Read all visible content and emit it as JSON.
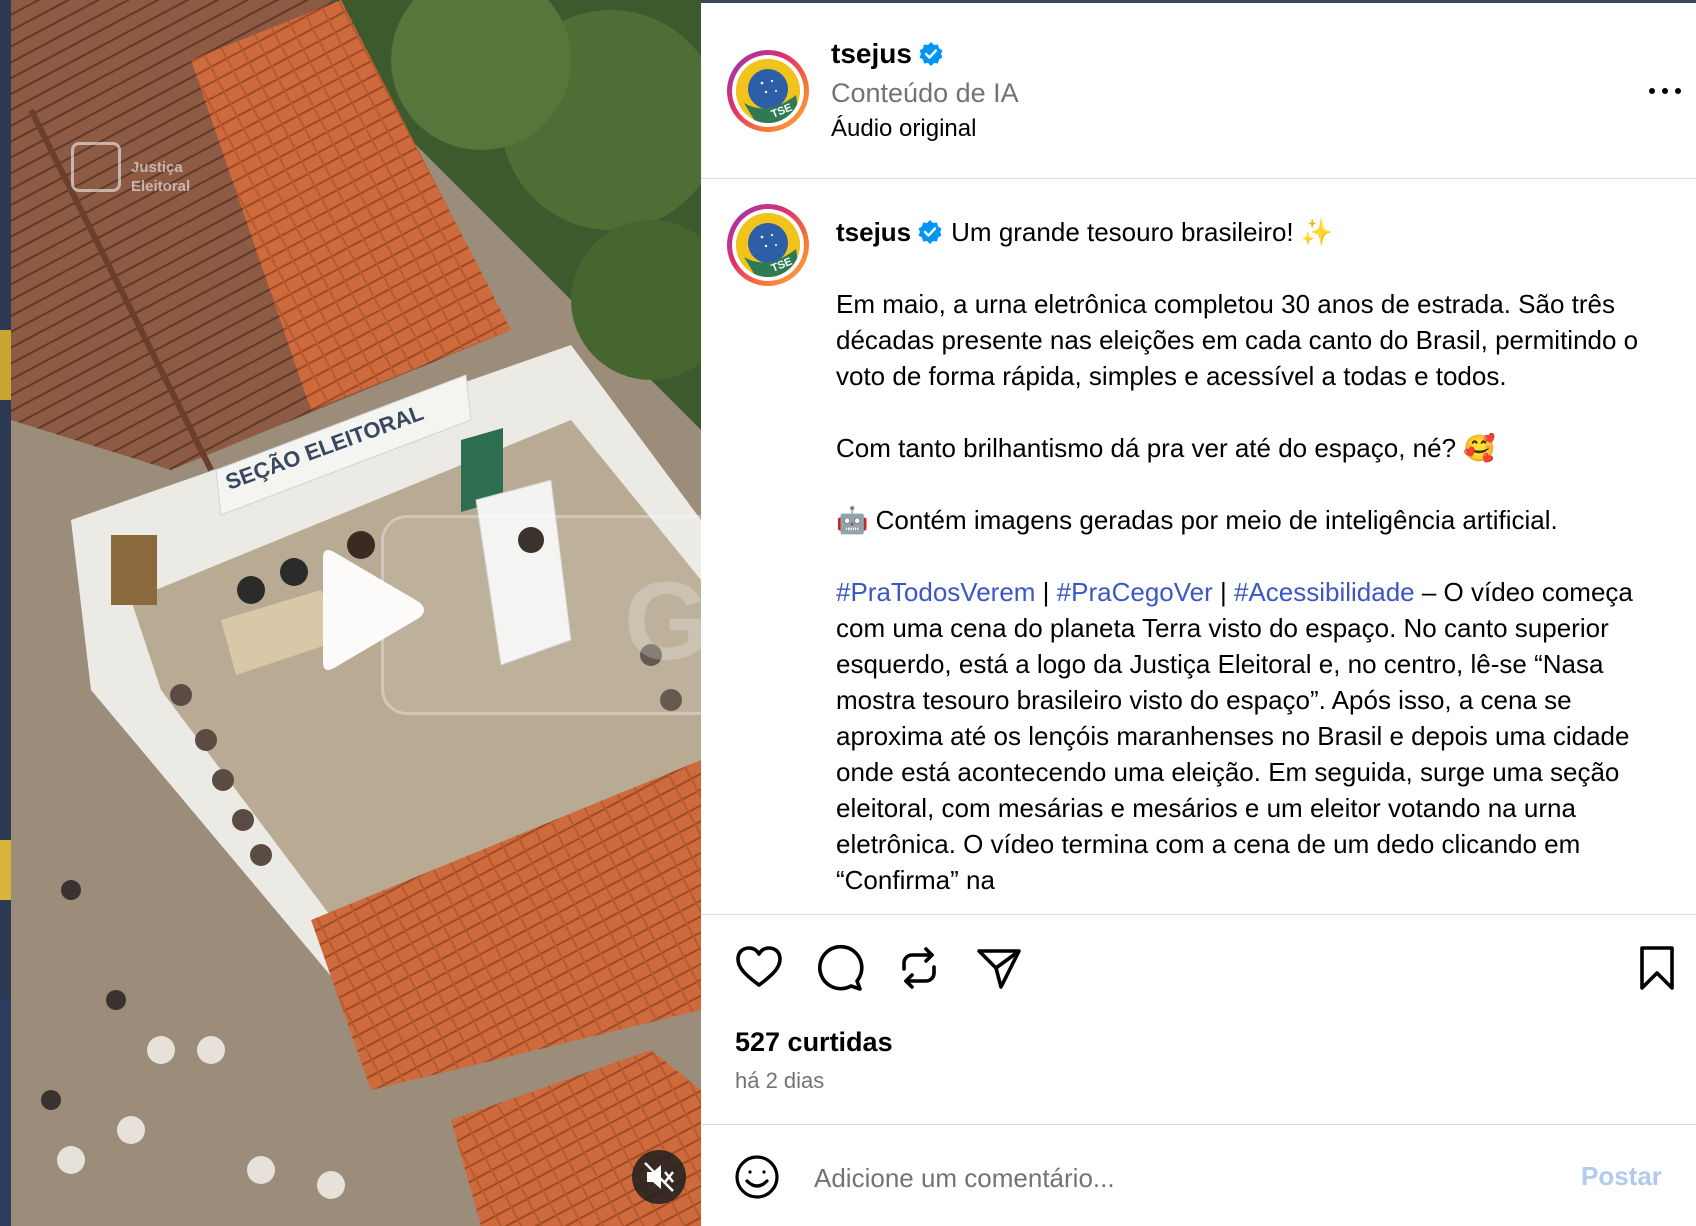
{
  "video": {
    "watermark_line1": "Justiça",
    "watermark_line2": "Eleitoral",
    "sign_text": "SEÇÃO ELEITORAL",
    "ai_watermark": "GERADO POR IA",
    "play_icon": "play-icon",
    "mute_icon": "speaker-muted-icon"
  },
  "header": {
    "username": "tsejus",
    "verified_icon": "verified-badge-icon",
    "subtitle": "Conteúdo de IA",
    "audio": "Áudio original",
    "avatar_label": "TSE",
    "more_icon": "more-options-icon"
  },
  "caption": {
    "username": "tsejus",
    "headline": "Um grande tesouro brasileiro! ✨",
    "paragraph1": "Em maio, a urna eletrônica completou 30 anos de estrada. São três décadas presente nas eleições em cada canto do Brasil, permitindo o voto de forma rápida, simples e acessível a todas e todos.",
    "paragraph2": "Com tanto brilhantismo dá pra ver até do espaço, né? 🥰",
    "paragraph3": "🤖 Contém imagens geradas por meio de inteligência artificial.",
    "hashtag1": "#PraTodosVerem",
    "separator": " | ",
    "hashtag2": "#PraCegoVer",
    "hashtag3": "#Acessibilidade",
    "description": " – O vídeo começa com uma cena do planeta Terra visto do espaço. No canto superior esquerdo, está a logo da Justiça Eleitoral e, no centro, lê-se “Nasa mostra tesouro brasileiro visto do espaço”. Após isso, a cena se aproxima até os lençóis maranhenses no Brasil e depois uma cidade onde está acontecendo uma eleição. Em seguida, surge uma seção eleitoral, com mesárias e mesários e um eleitor votando na urna eletrônica. O vídeo termina com a cena de um dedo clicando em “Confirma” na"
  },
  "actions": {
    "like_icon": "heart-icon",
    "comment_icon": "comment-icon",
    "repost_icon": "repost-icon",
    "share_icon": "share-icon",
    "save_icon": "bookmark-icon",
    "likes": "527 curtidas",
    "timestamp": "há 2 dias"
  },
  "comment": {
    "emoji_icon": "emoji-icon",
    "placeholder": "Adicione um comentário...",
    "post_label": "Postar"
  },
  "colors": {
    "hashtag": "#3a56c9",
    "verified": "#0095f6",
    "post_button_disabled": "#b2c9f0",
    "muted_text": "#737373"
  }
}
